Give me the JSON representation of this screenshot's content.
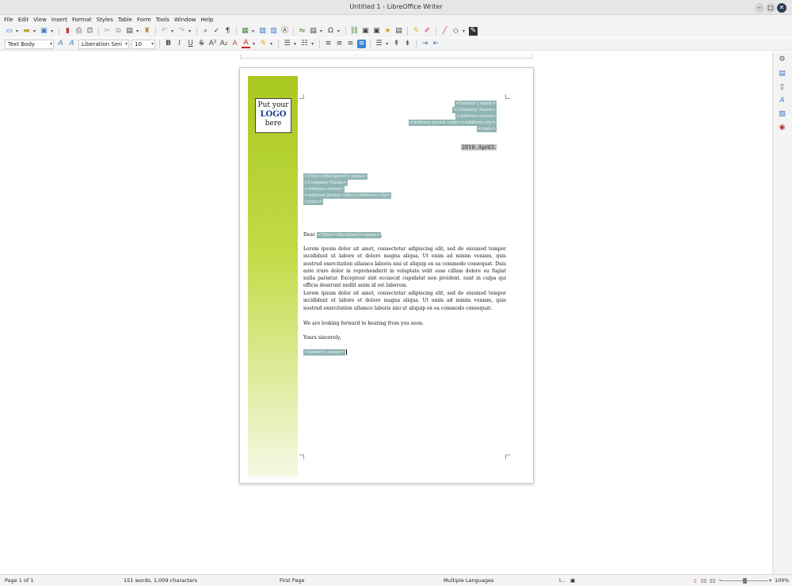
{
  "window": {
    "title": "Untitled 1 - LibreOffice Writer"
  },
  "menu": [
    "File",
    "Edit",
    "View",
    "Insert",
    "Format",
    "Styles",
    "Table",
    "Form",
    "Tools",
    "Window",
    "Help"
  ],
  "formatting": {
    "paragraph_style": "Text Body",
    "font_name": "Liberation Seri",
    "font_size": "10"
  },
  "colors": {
    "accent_green": "#a9c81f",
    "field_shading": "#8fb5b3",
    "logo_blue": "#1a3d8f",
    "active_button": "#3583d8"
  },
  "logo": {
    "line1": "Put your",
    "line2": "LOGO",
    "line3": "here"
  },
  "sender": {
    "name": "<Sender's name>",
    "company": "<Company Name>",
    "street": "<Address street>",
    "postal_city": "<Address postal code><Address city>",
    "state": "<state>"
  },
  "date": "2019. April3.",
  "recipient": {
    "title_name": "<Title><Recipient's name>",
    "company": "<Company Name>",
    "street": "<Address street>",
    "postal_city": "<Address postal code><Address city>",
    "state": "<state>"
  },
  "letter": {
    "dear": "Dear",
    "dear_field": "<Title><Recipient's name>",
    "dear_punct": ",",
    "paragraph1": "Lorem ipsum dolor sit amet, consectetur adipiscing elit, sed do eiusmod tempor incididunt ut labore et dolore magna aliqua. Ut enim ad minim veniam, quis nostrud exercitation ullamco laboris nisi ut aliquip ex ea commodo consequat. Duis aute irure dolor in reprehenderit in voluptate velit esse cillum dolore eu fugiat nulla pariatur. Excepteur sint occaecat cupidatat non proident, sunt in culpa qui officia deserunt mollit anim id est laborum.",
    "paragraph2": "Lorem ipsum dolor sit amet, consectetur adipiscing elit, sed do eiusmod tempor incididunt ut labore et dolore magna aliqua. Ut enim ad minim veniam, quis nostrud exercitation ullamco laboris nisi ut aliquip ex ea commodo consequat.",
    "closing1": "We are looking forward to hearing from you soon.",
    "closing2": "Yours sincerely,",
    "signature": "<Sender's name>"
  },
  "status": {
    "page": "Page 1 of 1",
    "words": "151 words, 1,009 characters",
    "page_style": "First Page",
    "language": "Multiple Languages",
    "zoom": "100%"
  }
}
